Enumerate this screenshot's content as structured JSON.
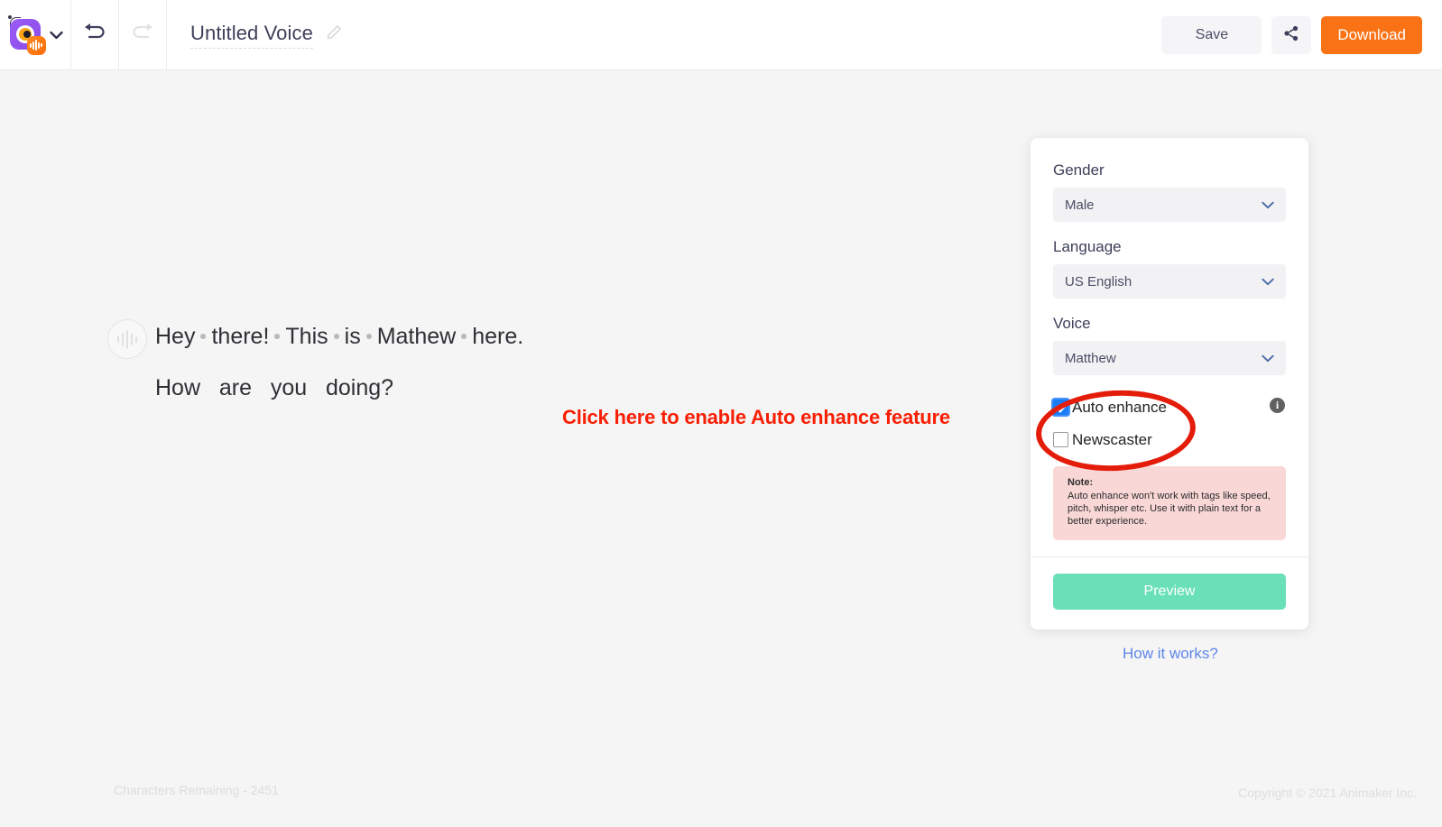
{
  "header": {
    "logo_icon": "animaker-voice-logo-icon",
    "logo_caret_icon": "chevron-down-icon",
    "undo_icon": "undo-arrow-icon",
    "redo_icon": "redo-arrow-icon",
    "project_title": "Untitled Voice",
    "edit_title_icon": "pencil-edit-icon",
    "save_label": "Save",
    "share_icon": "share-nodes-icon",
    "download_label": "Download",
    "download_color": "#f97316"
  },
  "script": {
    "waveform_icon": "audio-waveform-icon",
    "line1_words": [
      "Hey",
      "there!",
      "This",
      "is",
      "Mathew",
      "here."
    ],
    "line2": "How   are   you   doing?"
  },
  "annotation": {
    "text": "Click here to enable Auto enhance feature",
    "color": "#f81f05",
    "ellipse_color": "#e41c0a"
  },
  "panel": {
    "gender": {
      "label": "Gender",
      "value": "Male",
      "caret_icon": "chevron-down-icon"
    },
    "language": {
      "label": "Language",
      "value": "US English",
      "caret_icon": "chevron-down-icon"
    },
    "voice": {
      "label": "Voice",
      "value": "Matthew",
      "caret_icon": "chevron-down-icon"
    },
    "auto_enhance": {
      "label": "Auto enhance",
      "checked": true
    },
    "newscaster": {
      "label": "Newscaster",
      "checked": false
    },
    "info_icon": "info-circle-icon",
    "info_glyph": "i",
    "note": {
      "title": "Note:",
      "body": "Auto enhance won't work with tags like speed, pitch, whisper etc. Use it with plain text for a better experience.",
      "bg_color": "#fad7d7"
    },
    "preview_label": "Preview",
    "preview_color": "#6ae0b8"
  },
  "how_it_works_label": "How it works?",
  "footer": {
    "characters_remaining": "Characters Remaining - 2451",
    "copyright": "Copyright © 2021 Animaker Inc."
  }
}
